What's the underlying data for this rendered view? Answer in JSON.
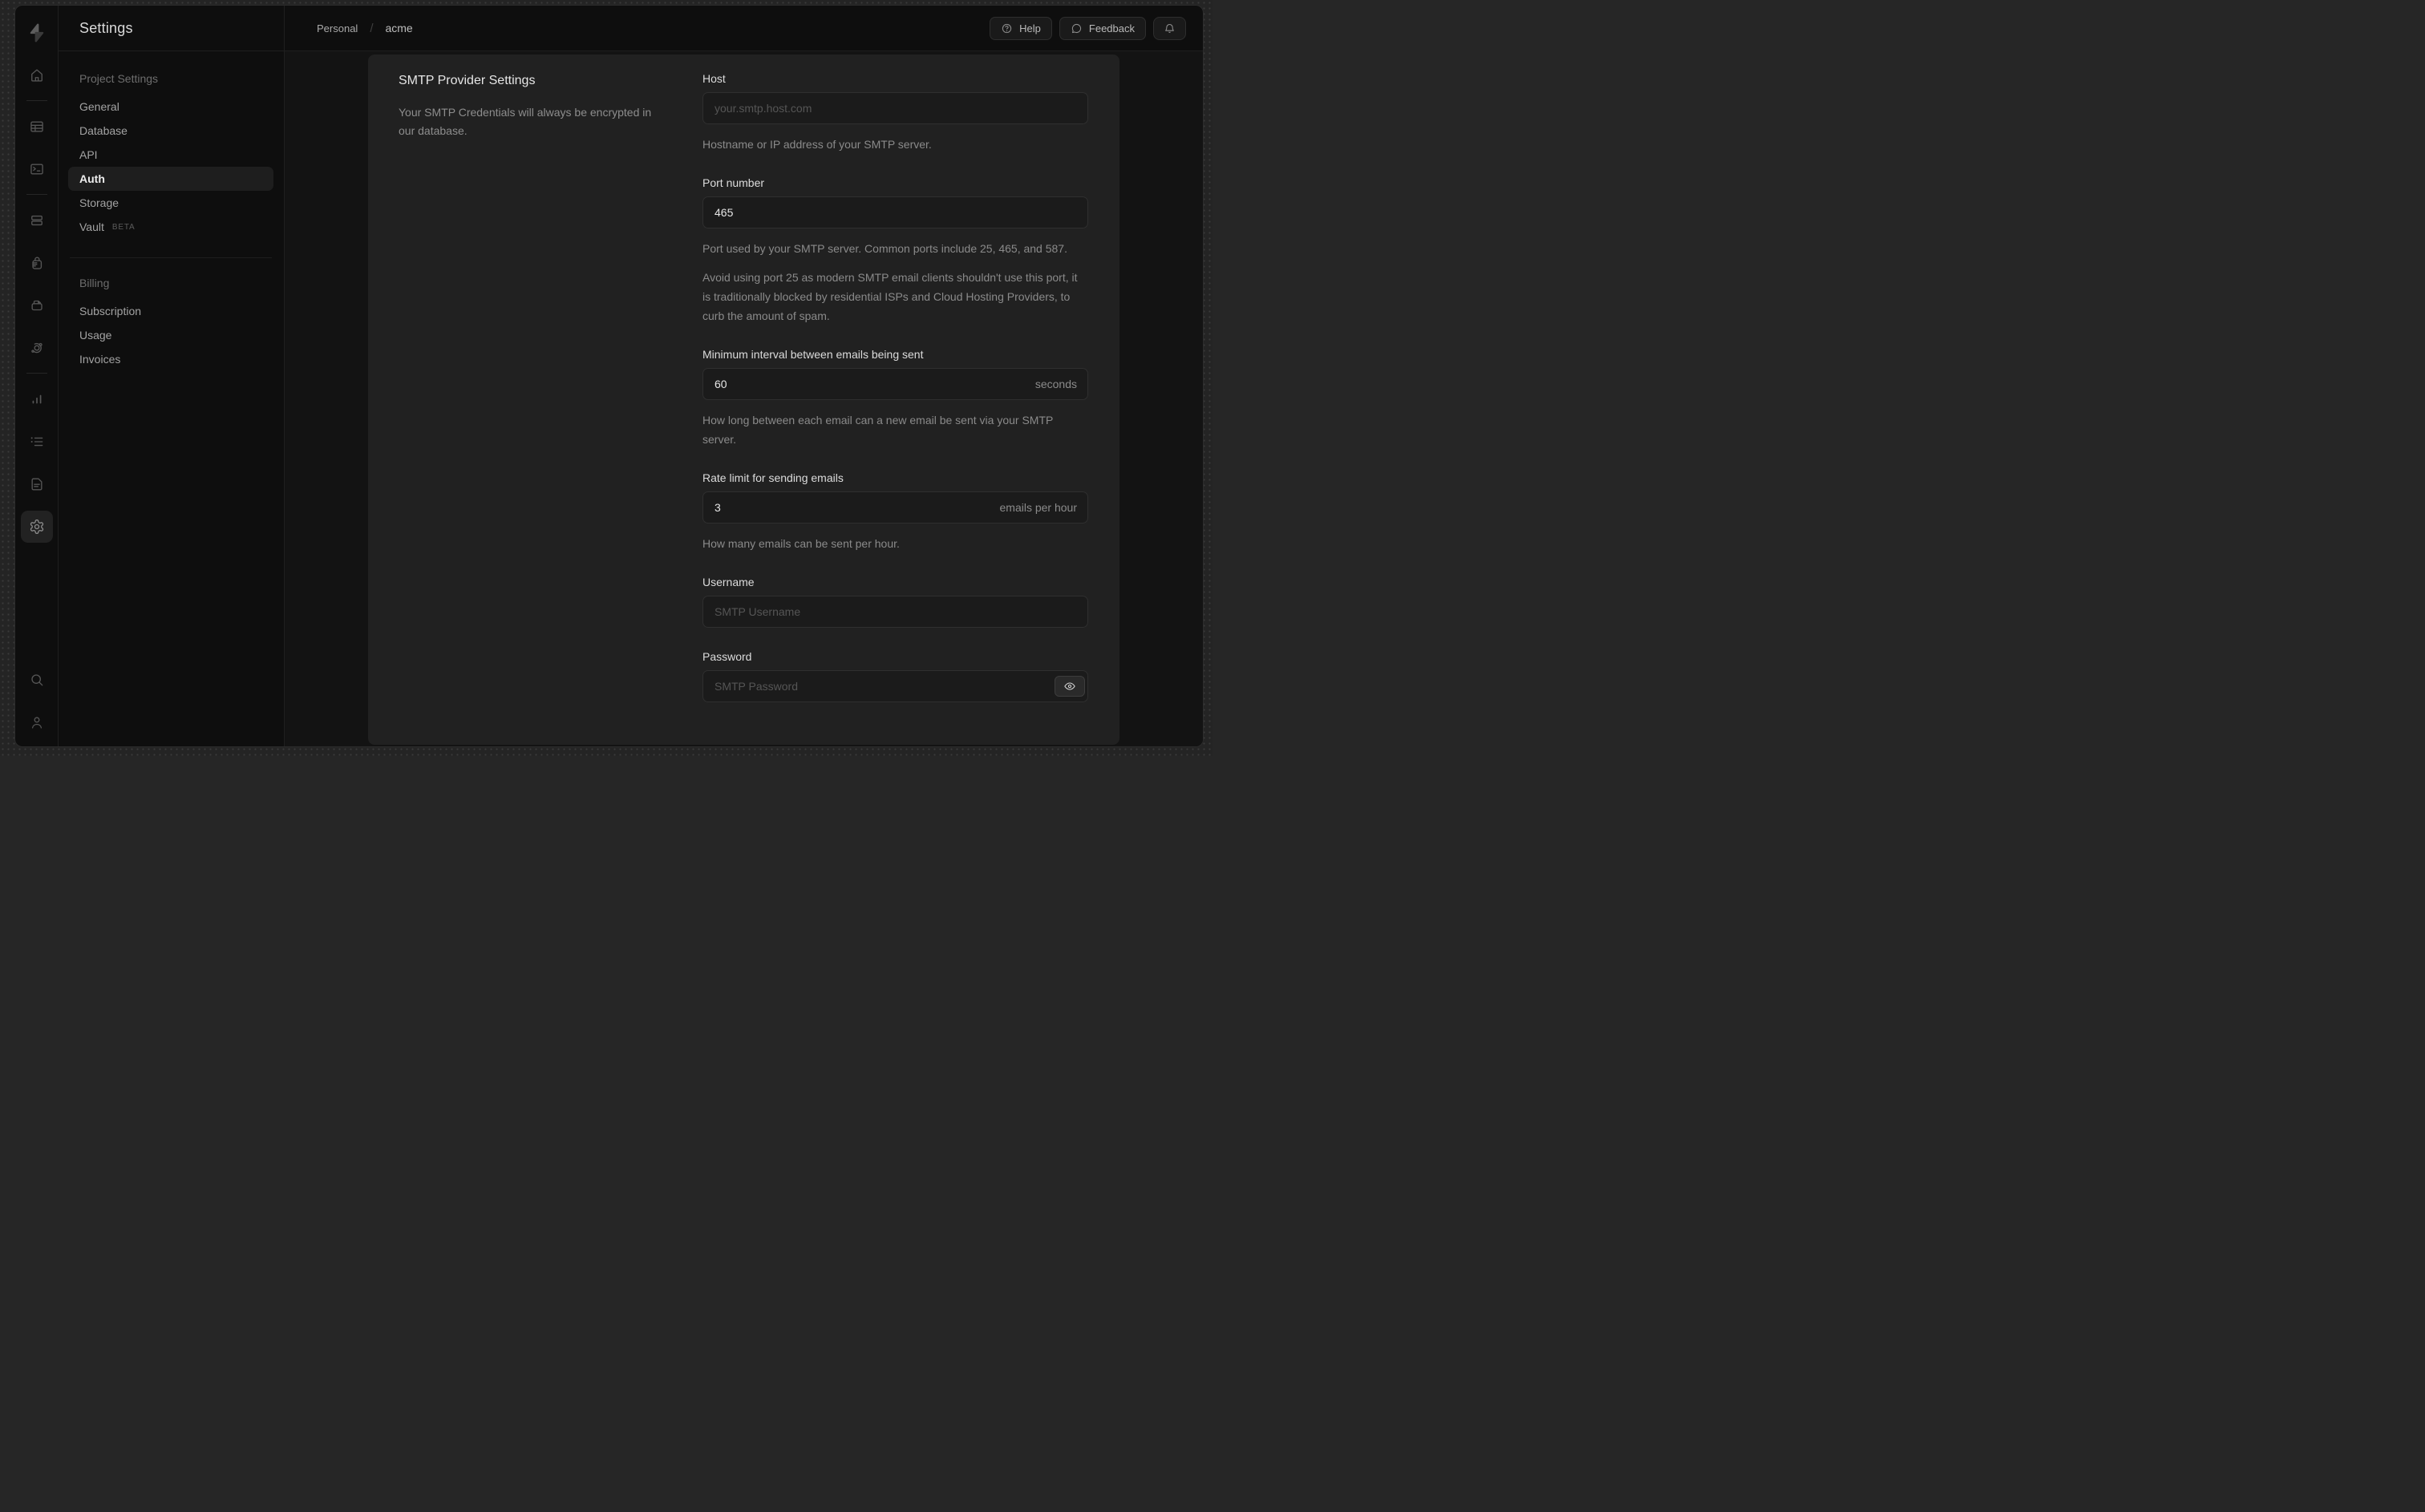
{
  "colors": {
    "desktop_bg": "#242424",
    "window_bg": "#0e0e0e",
    "content_bg": "#131313",
    "card_bg": "#212121",
    "input_bg": "#1b1b1b",
    "border": "#2f2f2f",
    "text_primary": "#e6e6e6",
    "text_muted": "#8a8a8a",
    "placeholder": "#555555"
  },
  "rail_icons": [
    "supabase-logo",
    "home",
    "table-editor",
    "sql-editor",
    "database",
    "authentication",
    "storage",
    "edge-functions",
    "reports",
    "logs",
    "api-docs",
    "project-settings",
    "search",
    "account"
  ],
  "sidebar_menu": {
    "title": "Settings",
    "sections": [
      {
        "header": "Project Settings",
        "items": [
          {
            "label": "General"
          },
          {
            "label": "Database"
          },
          {
            "label": "API"
          },
          {
            "label": "Auth",
            "active": true
          },
          {
            "label": "Storage"
          },
          {
            "label": "Vault",
            "badge": "BETA"
          }
        ]
      },
      {
        "header": "Billing",
        "items": [
          {
            "label": "Subscription"
          },
          {
            "label": "Usage"
          },
          {
            "label": "Invoices"
          }
        ]
      }
    ]
  },
  "breadcrumb": {
    "org": "Personal",
    "separator": "/",
    "project": "acme"
  },
  "topbar": {
    "help_label": "Help",
    "feedback_label": "Feedback"
  },
  "smtp": {
    "title": "SMTP Provider Settings",
    "description": "Your SMTP Credentials will always be encrypted in our database.",
    "host": {
      "label": "Host",
      "placeholder": "your.smtp.host.com",
      "help": "Hostname or IP address of your SMTP server."
    },
    "port": {
      "label": "Port number",
      "value": "465",
      "help": "Port used by your SMTP server. Common ports include 25, 465, and 587.",
      "note": "Avoid using port 25 as modern SMTP email clients shouldn't use this port, it is traditionally blocked by residential ISPs and Cloud Hosting Providers, to curb the amount of spam."
    },
    "interval": {
      "label": "Minimum interval between emails being sent",
      "value": "60",
      "unit": "seconds",
      "help": "How long between each email can a new email be sent via your SMTP server."
    },
    "rate": {
      "label": "Rate limit for sending emails",
      "value": "3",
      "unit": "emails per hour",
      "help": "How many emails can be sent per hour."
    },
    "username": {
      "label": "Username",
      "placeholder": "SMTP Username"
    },
    "password": {
      "label": "Password",
      "placeholder": "SMTP Password"
    }
  }
}
